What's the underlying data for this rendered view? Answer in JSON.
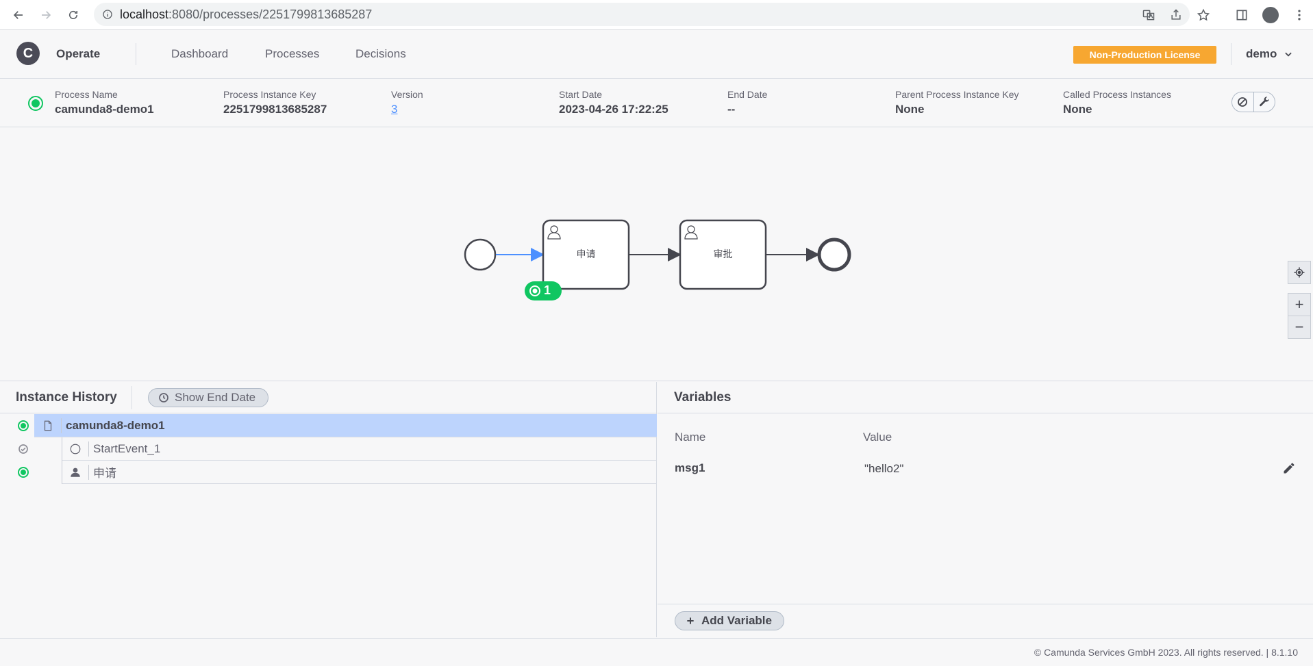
{
  "browser": {
    "url_host": "localhost",
    "url_rest": ":8080/processes/2251799813685287"
  },
  "header": {
    "logo_letter": "C",
    "app_name": "Operate",
    "nav": [
      "Dashboard",
      "Processes",
      "Decisions"
    ],
    "license_label": "Non-Production License",
    "user": "demo"
  },
  "instance": {
    "fields": [
      {
        "label": "Process Name",
        "value": "camunda8-demo1"
      },
      {
        "label": "Process Instance Key",
        "value": "2251799813685287"
      },
      {
        "label": "Version",
        "value": "3"
      },
      {
        "label": "Start Date",
        "value": "2023-04-26 17:22:25"
      },
      {
        "label": "End Date",
        "value": "--"
      },
      {
        "label": "Parent Process Instance Key",
        "value": "None"
      },
      {
        "label": "Called Process Instances",
        "value": "None"
      }
    ]
  },
  "diagram": {
    "task1_label": "申请",
    "task2_label": "审批",
    "active_count": "1",
    "zoom_in": "+",
    "zoom_out": "−"
  },
  "history": {
    "title": "Instance History",
    "show_end_date": "Show End Date",
    "rows": [
      {
        "label": "camunda8-demo1",
        "state": "active",
        "icon": "document-icon"
      },
      {
        "label": "StartEvent_1",
        "state": "completed",
        "icon": "start-event-icon"
      },
      {
        "label": "申请",
        "state": "active",
        "icon": "user-task-icon"
      }
    ]
  },
  "variables": {
    "title": "Variables",
    "col_name": "Name",
    "col_value": "Value",
    "items": [
      {
        "name": "msg1",
        "value": "\"hello2\""
      }
    ],
    "add_label": "Add Variable"
  },
  "footer": {
    "text": "© Camunda Services GmbH 2023. All rights reserved. | 8.1.10"
  },
  "colors": {
    "active_green": "#10c661",
    "license_orange": "#f7a731",
    "selection_blue": "#bdd4fd",
    "flow_blue": "#4d90ff"
  }
}
